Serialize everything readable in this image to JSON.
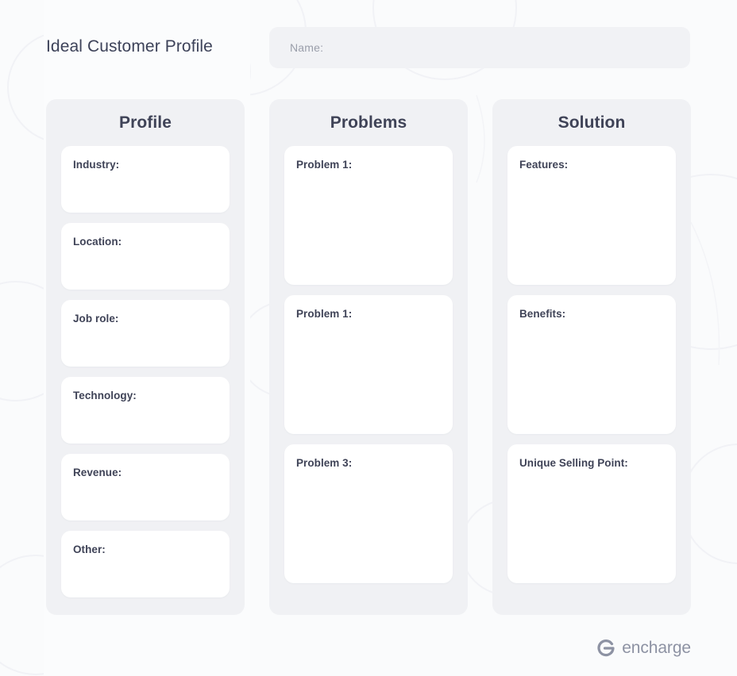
{
  "header": {
    "title": "Ideal Customer Profile",
    "name_field": {
      "label": "Name:",
      "value": ""
    }
  },
  "columns": [
    {
      "id": "profile",
      "title": "Profile",
      "cards": [
        {
          "label": "Industry:",
          "value": ""
        },
        {
          "label": "Location:",
          "value": ""
        },
        {
          "label": "Job role:",
          "value": ""
        },
        {
          "label": "Technology:",
          "value": ""
        },
        {
          "label": "Revenue:",
          "value": ""
        },
        {
          "label": "Other:",
          "value": ""
        }
      ]
    },
    {
      "id": "problems",
      "title": "Problems",
      "cards": [
        {
          "label": "Problem 1:",
          "value": ""
        },
        {
          "label": "Problem 1:",
          "value": ""
        },
        {
          "label": "Problem 3:",
          "value": ""
        }
      ]
    },
    {
      "id": "solution",
      "title": "Solution",
      "cards": [
        {
          "label": "Features:",
          "value": ""
        },
        {
          "label": "Benefits:",
          "value": ""
        },
        {
          "label": "Unique Selling Point:",
          "value": ""
        }
      ]
    }
  ],
  "footer": {
    "logo_icon": "encharge-circle-icon",
    "brand": "encharge"
  },
  "colors": {
    "page_background": "#fafbfc",
    "column_background": "#f0f1f4",
    "card_background": "#ffffff",
    "heading_text": "#3f4357",
    "title_text": "#3d4259",
    "placeholder_text": "#9a9eaa",
    "name_field_background": "#f1f2f5",
    "logo": "#8d92a3"
  }
}
